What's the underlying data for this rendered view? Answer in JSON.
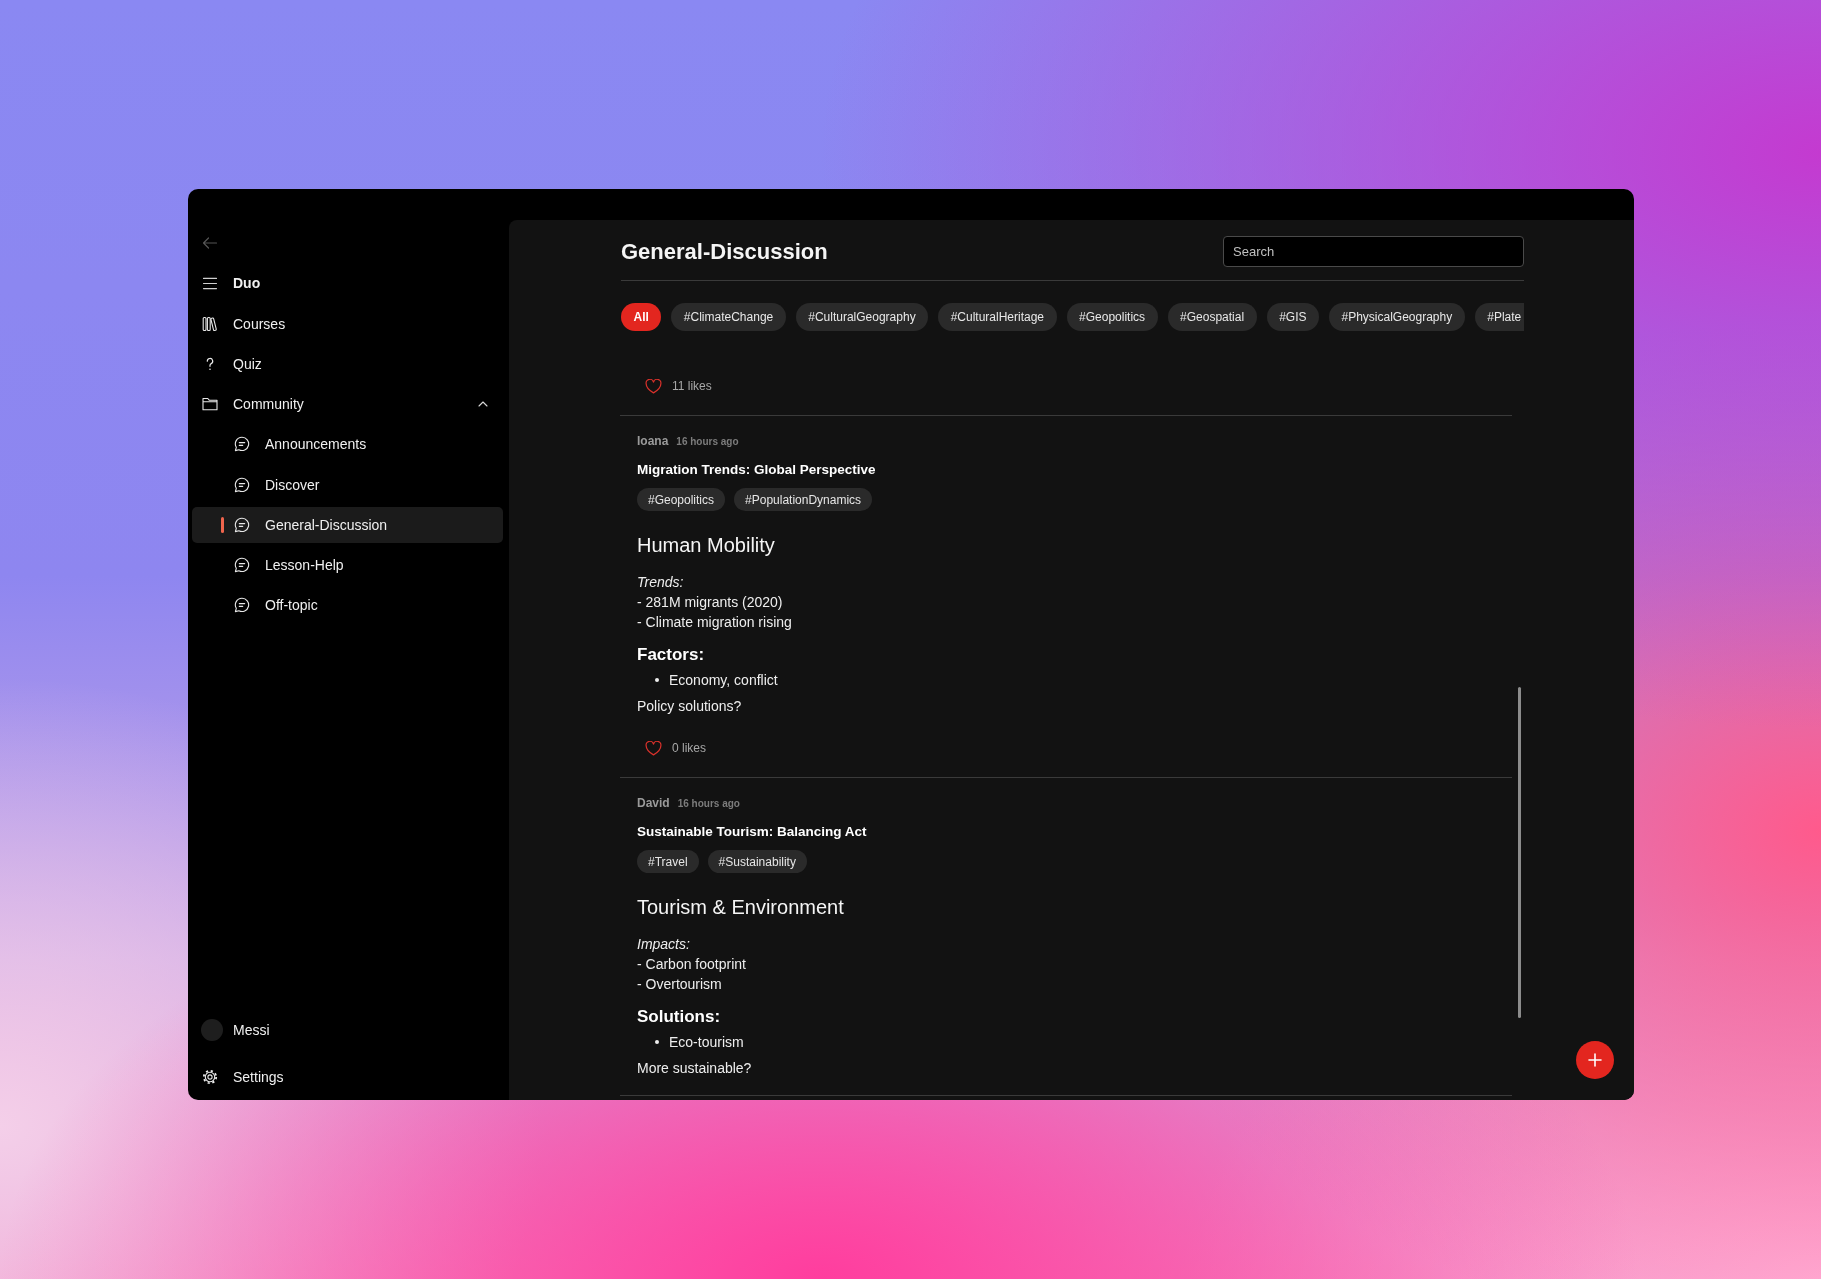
{
  "window": {
    "back_button": {
      "disabled": true
    }
  },
  "sidebar": {
    "app_name": "Duo",
    "items": [
      {
        "label": "Courses",
        "selected": false
      },
      {
        "label": "Quiz",
        "selected": false
      },
      {
        "label": "Community",
        "selected": false,
        "expanded": true,
        "children": [
          {
            "label": "Announcements",
            "selected": false
          },
          {
            "label": "Discover",
            "selected": false
          },
          {
            "label": "General-Discussion",
            "selected": true
          },
          {
            "label": "Lesson-Help",
            "selected": false
          },
          {
            "label": "Off-topic",
            "selected": false
          }
        ]
      }
    ],
    "user": {
      "name": "Messi"
    },
    "settings": {
      "label": "Settings"
    }
  },
  "page": {
    "title": "General-Discussion",
    "search": {
      "placeholder": "Search"
    },
    "filters": [
      {
        "label": "All",
        "selected": true
      },
      {
        "label": "#ClimateChange",
        "selected": false
      },
      {
        "label": "#CulturalGeography",
        "selected": false
      },
      {
        "label": "#CulturalHeritage",
        "selected": false
      },
      {
        "label": "#Geopolitics",
        "selected": false
      },
      {
        "label": "#Geospatial",
        "selected": false
      },
      {
        "label": "#GIS",
        "selected": false
      },
      {
        "label": "#PhysicalGeography",
        "selected": false
      },
      {
        "label": "#Plate",
        "selected": false
      }
    ]
  },
  "posts": [
    {
      "likes": "11 likes"
    },
    {
      "author": "Ioana",
      "time": "16 hours ago",
      "title": "Migration Trends: Global Perspective",
      "tags": [
        "#Geopolitics",
        "#PopulationDynamics"
      ],
      "body": [
        {
          "kind": "heading",
          "text": "Human Mobility"
        },
        {
          "kind": "note",
          "text": "Trends:"
        },
        {
          "kind": "line",
          "text": "- 281M migrants (2020)"
        },
        {
          "kind": "line",
          "text": "- Climate migration rising"
        },
        {
          "kind": "subheading",
          "text": "Factors:"
        },
        {
          "kind": "bullet",
          "text": "Economy, conflict"
        },
        {
          "kind": "paragraph",
          "text": "Policy solutions?"
        }
      ],
      "likes": "0 likes"
    },
    {
      "author": "David",
      "time": "16 hours ago",
      "title": "Sustainable Tourism: Balancing Act",
      "tags": [
        "#Travel",
        "#Sustainability"
      ],
      "body": [
        {
          "kind": "heading",
          "text": "Tourism & Environment"
        },
        {
          "kind": "note",
          "text": "Impacts:"
        },
        {
          "kind": "line",
          "text": "- Carbon footprint"
        },
        {
          "kind": "line",
          "text": "- Overtourism"
        },
        {
          "kind": "subheading",
          "text": "Solutions:"
        },
        {
          "kind": "bullet",
          "text": "Eco-tourism"
        },
        {
          "kind": "paragraph",
          "text": "More sustainable?"
        }
      ]
    }
  ]
}
